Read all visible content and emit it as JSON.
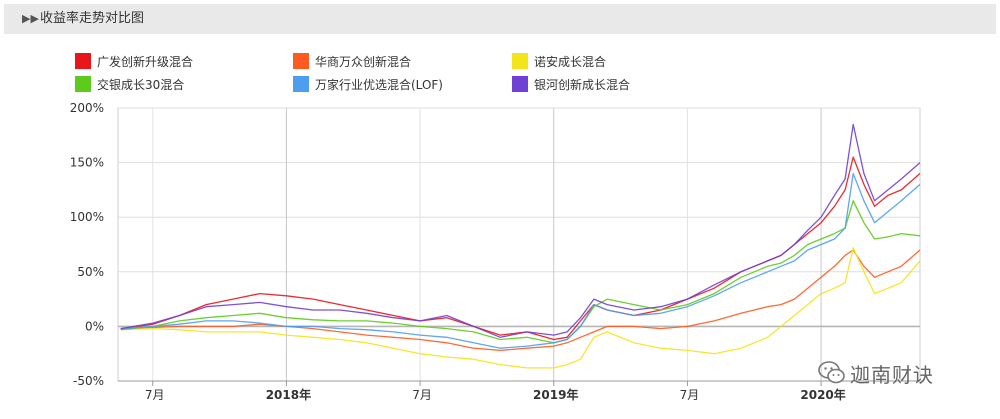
{
  "header": {
    "title": "收益率走势对比图",
    "icon": "double-chevron-right-icon"
  },
  "legend": [
    {
      "label": "广发创新升级混合",
      "color": "#e8151b"
    },
    {
      "label": "华商万众创新混合",
      "color": "#ff5a1f"
    },
    {
      "label": "诺安成长混合",
      "color": "#f4e41a"
    },
    {
      "label": "交银成长30混合",
      "color": "#5ccb1b"
    },
    {
      "label": "万家行业优选混合(LOF)",
      "color": "#4d9df0"
    },
    {
      "label": "银河创新成长混合",
      "color": "#6f3fd6"
    }
  ],
  "watermark": {
    "text": "迦南财诀",
    "icon": "wechat-icon"
  },
  "chart_data": {
    "type": "line",
    "title": "收益率走势对比图",
    "xlabel": "",
    "ylabel": "",
    "x_tick_labels": [
      "7月",
      "2018年",
      "7月",
      "2019年",
      "7月",
      "2020年"
    ],
    "x_tick_positions": [
      2017.5,
      2018.0,
      2018.5,
      2019.0,
      2019.5,
      2020.0
    ],
    "y_tick_labels": [
      "200%",
      "150%",
      "100%",
      "50%",
      "0%",
      "-50%"
    ],
    "xlim": [
      2017.37,
      2020.37
    ],
    "ylim": [
      -50,
      200
    ],
    "grid": true,
    "legend_position": "top",
    "x": [
      2017.38,
      2017.5,
      2017.6,
      2017.7,
      2017.8,
      2017.9,
      2018.0,
      2018.1,
      2018.2,
      2018.3,
      2018.4,
      2018.5,
      2018.6,
      2018.7,
      2018.8,
      2018.9,
      2019.0,
      2019.05,
      2019.1,
      2019.15,
      2019.2,
      2019.3,
      2019.4,
      2019.5,
      2019.6,
      2019.7,
      2019.75,
      2019.8,
      2019.85,
      2019.9,
      2019.95,
      2020.0,
      2020.05,
      2020.09,
      2020.12,
      2020.16,
      2020.2,
      2020.25,
      2020.3,
      2020.37
    ],
    "series": [
      {
        "name": "广发创新升级混合",
        "color": "#e8151b",
        "values": [
          -2,
          2,
          10,
          20,
          25,
          30,
          28,
          25,
          20,
          15,
          10,
          5,
          8,
          0,
          -8,
          -5,
          -12,
          -10,
          5,
          20,
          15,
          10,
          15,
          25,
          35,
          50,
          55,
          60,
          65,
          75,
          85,
          95,
          110,
          125,
          155,
          130,
          110,
          120,
          125,
          140
        ]
      },
      {
        "name": "华商万众创新混合",
        "color": "#ff5a1f",
        "values": [
          -2,
          -1,
          0,
          0,
          0,
          2,
          0,
          -2,
          -5,
          -8,
          -10,
          -12,
          -15,
          -20,
          -22,
          -20,
          -18,
          -15,
          -10,
          -5,
          0,
          0,
          -2,
          0,
          5,
          12,
          15,
          18,
          20,
          25,
          35,
          45,
          55,
          65,
          70,
          55,
          45,
          50,
          55,
          70
        ]
      },
      {
        "name": "诺安成长混合",
        "color": "#f4e41a",
        "values": [
          -3,
          -2,
          -3,
          -5,
          -5,
          -5,
          -8,
          -10,
          -12,
          -15,
          -20,
          -25,
          -28,
          -30,
          -35,
          -38,
          -38,
          -35,
          -30,
          -10,
          -5,
          -15,
          -20,
          -22,
          -25,
          -20,
          -15,
          -10,
          0,
          10,
          20,
          30,
          35,
          40,
          72,
          50,
          30,
          35,
          40,
          60
        ]
      },
      {
        "name": "交银成长30混合",
        "color": "#5ccb1b",
        "values": [
          -3,
          0,
          5,
          8,
          10,
          12,
          8,
          6,
          5,
          5,
          3,
          0,
          -2,
          -5,
          -12,
          -10,
          -15,
          -12,
          0,
          18,
          25,
          20,
          15,
          20,
          30,
          45,
          50,
          55,
          58,
          65,
          75,
          80,
          85,
          90,
          115,
          95,
          80,
          82,
          85,
          83
        ]
      },
      {
        "name": "万家行业优选混合(LOF)",
        "color": "#4d9df0",
        "values": [
          -2,
          0,
          2,
          5,
          5,
          3,
          0,
          0,
          -2,
          -3,
          -5,
          -8,
          -10,
          -15,
          -20,
          -18,
          -15,
          -12,
          0,
          20,
          15,
          10,
          12,
          18,
          28,
          40,
          45,
          50,
          55,
          60,
          70,
          75,
          80,
          90,
          140,
          115,
          95,
          105,
          115,
          130
        ]
      },
      {
        "name": "银河创新成长混合",
        "color": "#6f3fd6",
        "values": [
          -2,
          3,
          10,
          18,
          20,
          22,
          18,
          15,
          15,
          12,
          8,
          5,
          10,
          0,
          -10,
          -5,
          -8,
          -5,
          8,
          25,
          20,
          15,
          18,
          25,
          38,
          50,
          55,
          60,
          65,
          75,
          88,
          100,
          120,
          135,
          185,
          140,
          115,
          125,
          135,
          150
        ]
      }
    ]
  }
}
